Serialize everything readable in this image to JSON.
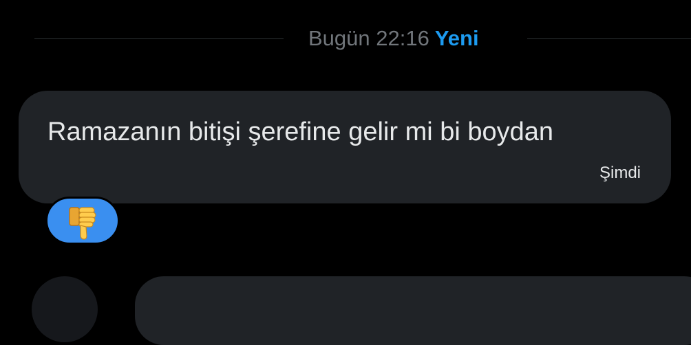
{
  "divider": {
    "date_label": "Bugün 22:16",
    "new_label": "Yeni"
  },
  "message": {
    "text": "Ramazanın bitişi şerefine gelir mi bi boydan",
    "time": "Şimdi",
    "reaction": {
      "icon": "thumbs-down-icon",
      "emoji": "👎"
    }
  },
  "colors": {
    "background": "#000000",
    "bubble": "#202327",
    "accent": "#1d9bf0",
    "reaction_bg": "#3a8ff0",
    "muted_text": "#71767b"
  }
}
